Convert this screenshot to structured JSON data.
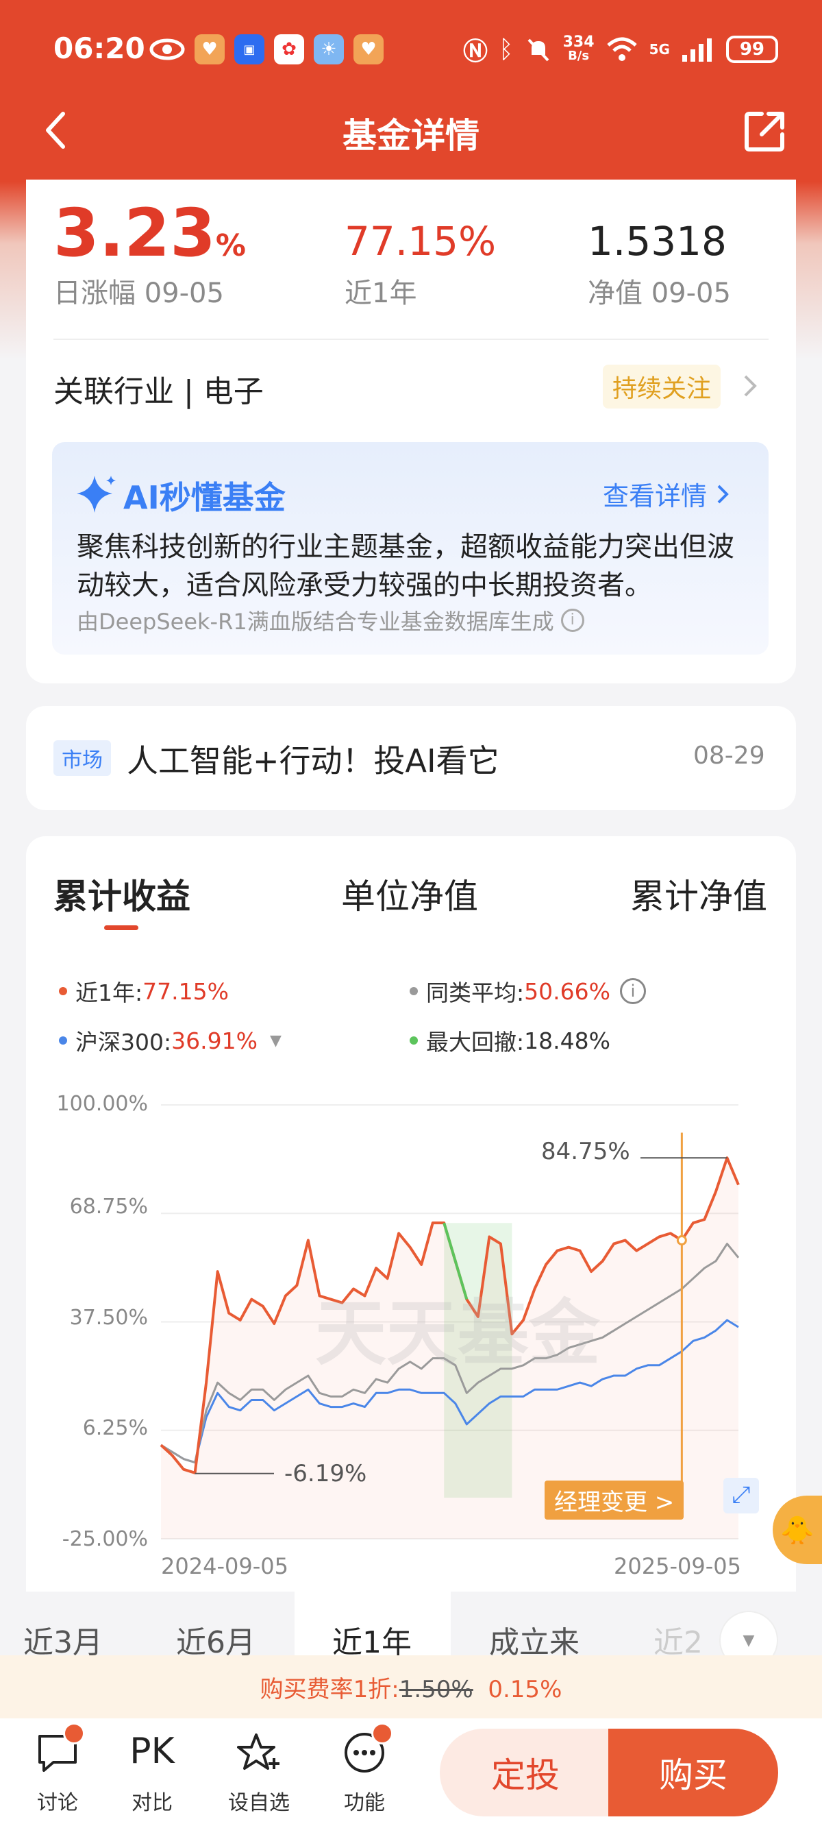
{
  "status_bar": {
    "time": "06:20",
    "network_speed_value": "334",
    "network_speed_unit": "B/s",
    "network": "5G",
    "battery": "99"
  },
  "header": {
    "title": "基金详情"
  },
  "summary": {
    "daily_change_value": "3.23",
    "daily_change_unit": "%",
    "daily_change_label": "日涨幅 09-05",
    "year_return": "77.15%",
    "year_label": "近1年",
    "nav_value": "1.5318",
    "nav_label": "净值 09-05"
  },
  "industry": {
    "label": "关联行业 | 电子",
    "tag": "持续关注"
  },
  "ai_card": {
    "title": "AI秒懂基金",
    "detail_link": "查看详情",
    "text": "聚焦科技创新的行业主题基金，超额收益能力突出但波动较大，适合风险承受力较强的中长期投资者。",
    "source": "由DeepSeek-R1满血版结合专业基金数据库生成"
  },
  "news": {
    "tag": "市场",
    "title": "人工智能+行动！投AI看它",
    "date": "08-29"
  },
  "chart_tabs": [
    "累计收益",
    "单位净值",
    "累计净值"
  ],
  "legend": {
    "fund_label": "近1年:",
    "fund_value": "77.15%",
    "peer_label": "同类平均:",
    "peer_value": "50.66%",
    "index_label": "沪深300:",
    "index_value": "36.91%",
    "drawdown_label": "最大回撤:",
    "drawdown_value": "18.48%"
  },
  "chart_annotations": {
    "max_label": "84.75%",
    "min_label": "-6.19%",
    "manager_change": "经理变更 >",
    "watermark": "天天基金"
  },
  "colors": {
    "fund": "#e85b34",
    "peer": "#9a9a9a",
    "index": "#4a86e8",
    "drawdown": "#5cc45c",
    "accent": "#e2472c"
  },
  "chart_data": {
    "type": "line",
    "yticks": [
      "100.00%",
      "68.75%",
      "37.50%",
      "6.25%",
      "-25.00%"
    ],
    "ylim": [
      -25,
      100
    ],
    "x_start": "2024-09-05",
    "x_end": "2025-09-05",
    "series": [
      {
        "name": "近1年",
        "values": [
          2,
          -1,
          -5,
          -6,
          20,
          52,
          40,
          38,
          44,
          42,
          37,
          45,
          48,
          61,
          45,
          44,
          43,
          47,
          45,
          53,
          50,
          63,
          59,
          54,
          66,
          66,
          55,
          44,
          39,
          62,
          60,
          34,
          38,
          47,
          54,
          58,
          59,
          58,
          52,
          55,
          60,
          61,
          58,
          60,
          62,
          63,
          61,
          66,
          67,
          75,
          84.75,
          77
        ]
      },
      {
        "name": "同类平均",
        "values": [
          2,
          0,
          -2,
          -3,
          12,
          20,
          17,
          15,
          18,
          18,
          15,
          18,
          20,
          22,
          17,
          16,
          16,
          18,
          17,
          21,
          20,
          24,
          26,
          24,
          27,
          27,
          25,
          17,
          20,
          22,
          24,
          24,
          25,
          27,
          27,
          28,
          30,
          31,
          32,
          33,
          35,
          37,
          39,
          41,
          43,
          45,
          47,
          50,
          53,
          55,
          60,
          56
        ]
      },
      {
        "name": "沪深300",
        "values": [
          2,
          0,
          -2,
          -3,
          10,
          17,
          13,
          12,
          15,
          15,
          12,
          14,
          16,
          18,
          14,
          13,
          13,
          14,
          13,
          17,
          17,
          18,
          18,
          17,
          17,
          17,
          14,
          8,
          11,
          14,
          16,
          16,
          16,
          18,
          18,
          18,
          19,
          20,
          19,
          21,
          22,
          22,
          24,
          25,
          25,
          27,
          29,
          32,
          33,
          35,
          38,
          36
        ]
      }
    ],
    "max_drawdown_value": "18.48%"
  },
  "ranges": [
    "近3月",
    "近6月",
    "近1年",
    "成立来",
    "近2"
  ],
  "fee": {
    "label": "购买费率1折:",
    "old": "1.50%",
    "new": "0.15%"
  },
  "bottom_nav": [
    {
      "label": "讨论"
    },
    {
      "label": "对比",
      "glyph": "PK"
    },
    {
      "label": "设自选"
    },
    {
      "label": "功能"
    }
  ],
  "actions": {
    "plan": "定投",
    "buy": "购买"
  }
}
